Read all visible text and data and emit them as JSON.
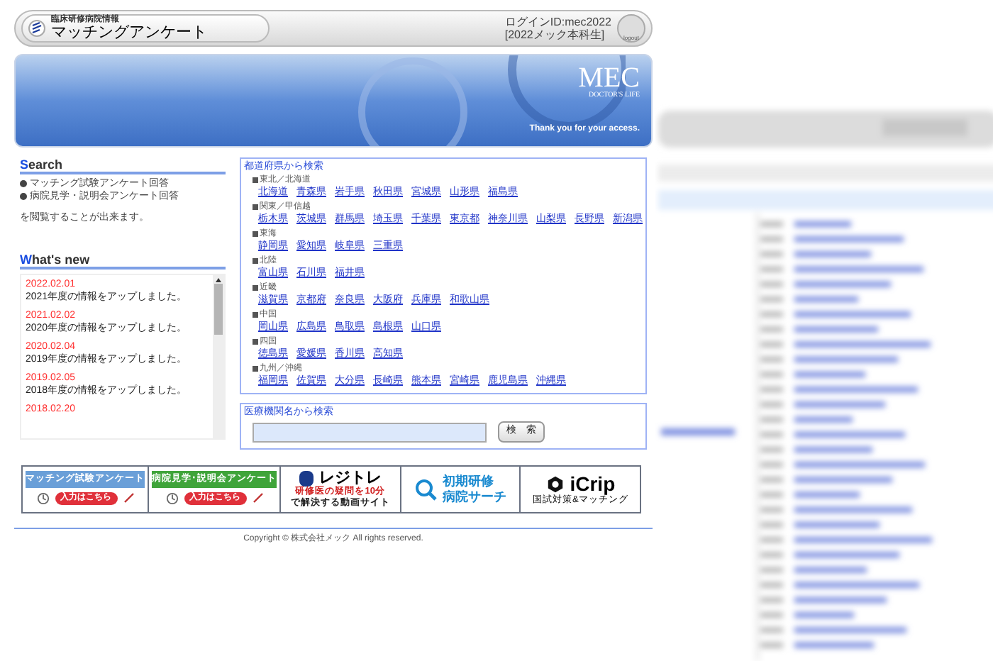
{
  "header": {
    "subtitle": "臨床研修病院情報",
    "title": "マッチングアンケート",
    "login_id": "ログインID:mec2022",
    "login_group": "[2022メック本科生]",
    "logout": "logout"
  },
  "banner": {
    "logo": "MEC",
    "tagline": "DOCTOR'S LIFE",
    "message": "Thank you for your access."
  },
  "search": {
    "heading_initial": "S",
    "heading_rest": "earch",
    "items": [
      "マッチング試験アンケート回答",
      "病院見学・説明会アンケート回答"
    ],
    "note": "を閲覧することが出来ます。"
  },
  "news": {
    "heading_initial": "W",
    "heading_rest": "hat's new",
    "entries": [
      {
        "date": "2022.02.01",
        "text": "2021年度の情報をアップしました。"
      },
      {
        "date": "2021.02.02",
        "text": "2020年度の情報をアップしました。"
      },
      {
        "date": "2020.02.04",
        "text": "2019年度の情報をアップしました。"
      },
      {
        "date": "2019.02.05",
        "text": "2018年度の情報をアップしました。"
      },
      {
        "date": "2018.02.20"
      }
    ]
  },
  "prefecture_search": {
    "title": "都道府県から検索",
    "regions": [
      {
        "name": "東北／北海道",
        "prefectures": [
          "北海道",
          "青森県",
          "岩手県",
          "秋田県",
          "宮城県",
          "山形県",
          "福島県"
        ]
      },
      {
        "name": "関東／甲信越",
        "prefectures": [
          "栃木県",
          "茨城県",
          "群馬県",
          "埼玉県",
          "千葉県",
          "東京都",
          "神奈川県",
          "山梨県",
          "長野県",
          "新潟県"
        ]
      },
      {
        "name": "東海",
        "prefectures": [
          "静岡県",
          "愛知県",
          "岐阜県",
          "三重県"
        ]
      },
      {
        "name": "北陸",
        "prefectures": [
          "富山県",
          "石川県",
          "福井県"
        ]
      },
      {
        "name": "近畿",
        "prefectures": [
          "滋賀県",
          "京都府",
          "奈良県",
          "大阪府",
          "兵庫県",
          "和歌山県"
        ]
      },
      {
        "name": "中国",
        "prefectures": [
          "岡山県",
          "広島県",
          "鳥取県",
          "島根県",
          "山口県"
        ]
      },
      {
        "name": "四国",
        "prefectures": [
          "徳島県",
          "愛媛県",
          "香川県",
          "高知県"
        ]
      },
      {
        "name": "九州／沖縄",
        "prefectures": [
          "福岡県",
          "佐賀県",
          "大分県",
          "長崎県",
          "熊本県",
          "宮崎県",
          "鹿児島県",
          "沖縄県"
        ]
      }
    ]
  },
  "name_search": {
    "title": "医療機関名から検索",
    "button": "検　索"
  },
  "links": [
    {
      "kind": "survey",
      "color": "#6a9fd8",
      "title": "マッチング試験アンケート",
      "action": "入力はこちら"
    },
    {
      "kind": "survey",
      "color": "#3fa43a",
      "title": "病院見学･説明会アンケート",
      "action": "入力はこちら"
    },
    {
      "kind": "regitore",
      "title": "レジトレ",
      "line1": "研修医の疑問を10分",
      "line2": "で解決する動画サイト"
    },
    {
      "kind": "hospital",
      "line1": "初期研修",
      "line2": "病院サーチ"
    },
    {
      "kind": "icrip",
      "title": "iCrip",
      "sub": "国試対策&マッチング"
    }
  ],
  "footer": {
    "copyright": "Copyright © 株式会社メック All rights reserved."
  }
}
